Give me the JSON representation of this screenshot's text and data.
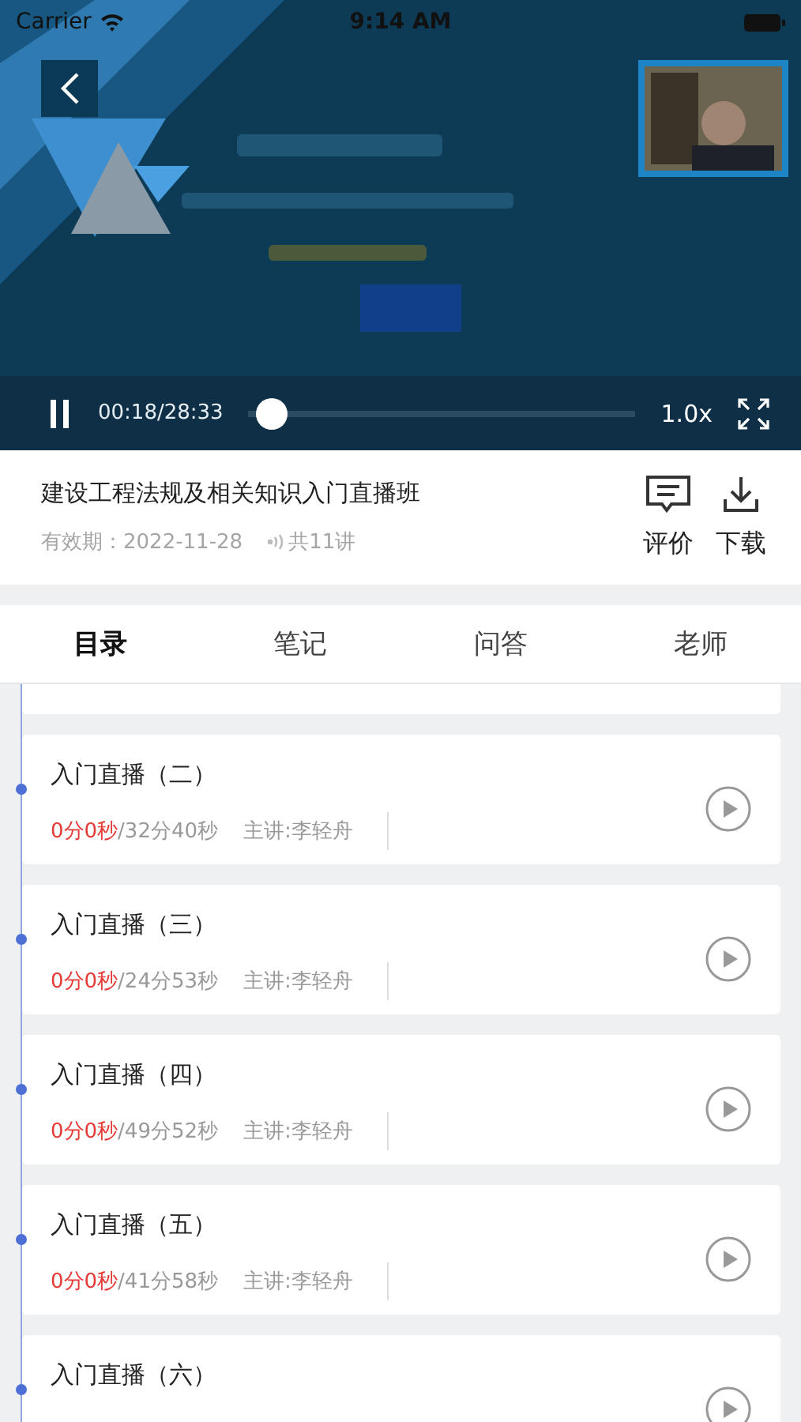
{
  "status_bar": {
    "carrier": "Carrier",
    "time": "9:14 AM"
  },
  "player": {
    "paused": false,
    "time": "00:18/28:33",
    "level": 0.02,
    "speed": "1.0x"
  },
  "course": {
    "title": "建设工程法规及相关知识入门直播班",
    "validity": "有效期：2022-11-28",
    "lessons": "共11讲",
    "actions": [
      {
        "kind": "review",
        "label": "评价"
      },
      {
        "kind": "download",
        "label": "下载"
      }
    ]
  },
  "tabs": [
    {
      "label": "目录",
      "selected": true
    },
    {
      "label": "笔记",
      "selected": false
    },
    {
      "label": "问答",
      "selected": false
    },
    {
      "label": "老师",
      "selected": false
    }
  ],
  "lessons": [
    {
      "title": "入门直播（二）",
      "watched": "0分0秒",
      "duration": "/32分40秒",
      "teacher": "主讲:李轻舟"
    },
    {
      "title": "入门直播（三）",
      "watched": "0分0秒",
      "duration": "/24分53秒",
      "teacher": "主讲:李轻舟"
    },
    {
      "title": "入门直播（四）",
      "watched": "0分0秒",
      "duration": "/49分52秒",
      "teacher": "主讲:李轻舟"
    },
    {
      "title": "入门直播（五）",
      "watched": "0分0秒",
      "duration": "/41分58秒",
      "teacher": "主讲:李轻舟"
    },
    {
      "title": "入门直播（六）"
    }
  ]
}
